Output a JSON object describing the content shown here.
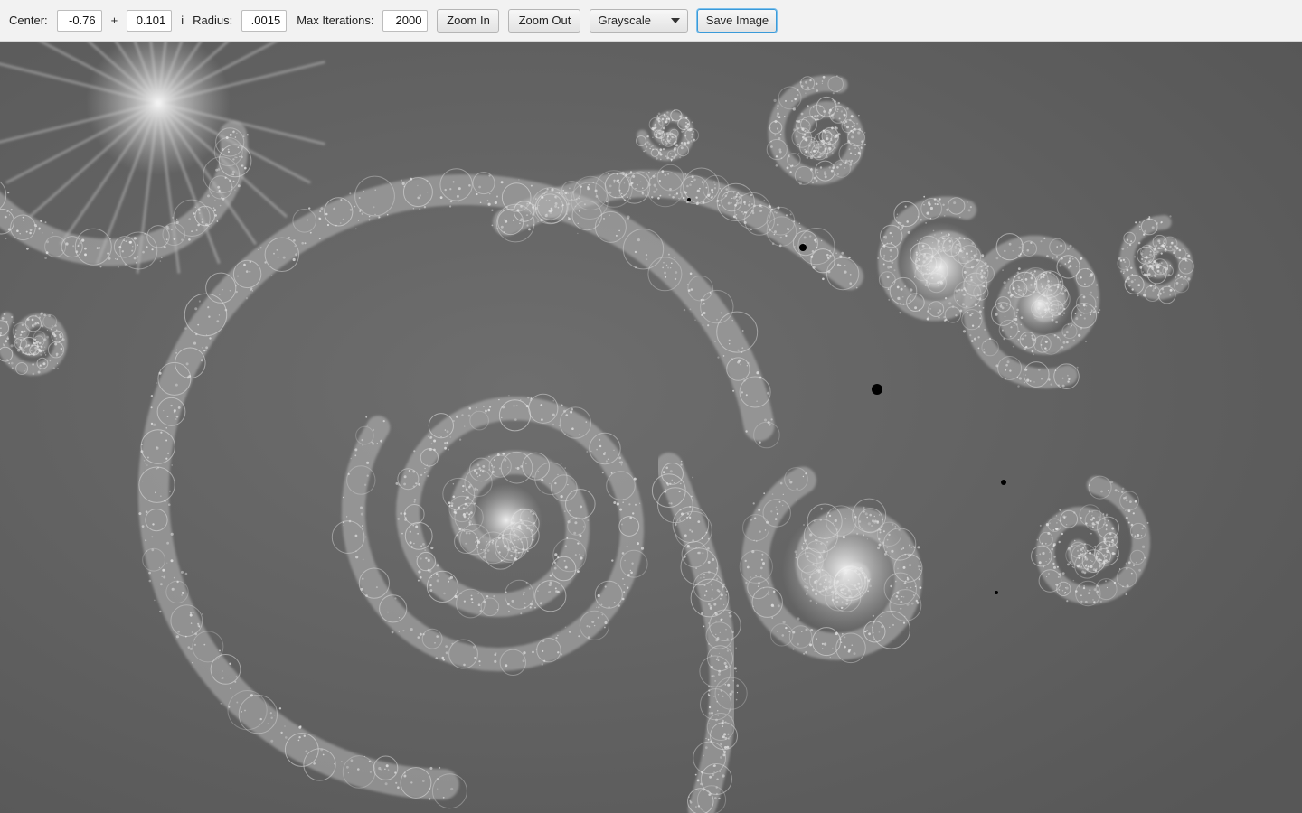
{
  "toolbar": {
    "center_label": "Center:",
    "center_real": "-0.76",
    "plus_label": "+",
    "center_imag": "0.101",
    "imag_unit_label": "i",
    "radius_label": "Radius:",
    "radius_value": ".0015",
    "max_iter_label": "Max Iterations:",
    "max_iter_value": "2000",
    "zoom_in_label": "Zoom In",
    "zoom_out_label": "Zoom Out",
    "color_scheme_selected": "Grayscale",
    "save_image_label": "Save Image"
  },
  "canvas": {
    "background_color": "#5c5c5c",
    "filament_color": "#b8b8b8",
    "bright_color": "#e6e6e6"
  }
}
